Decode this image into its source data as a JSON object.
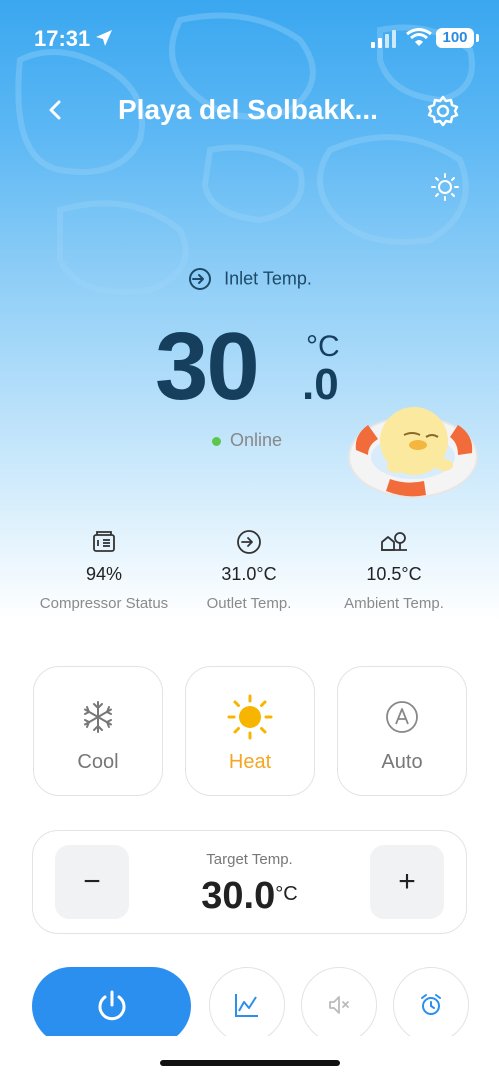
{
  "status_bar": {
    "time": "17:31",
    "battery": "100"
  },
  "header": {
    "title": "Playa del Solbakk..."
  },
  "main": {
    "inlet_label": "Inlet Temp.",
    "temp_integer": "30",
    "temp_decimal": ".0",
    "temp_unit": "°C",
    "status": "Online"
  },
  "stats": [
    {
      "value": "94%",
      "label": "Compressor Status",
      "icon": "compressor-icon"
    },
    {
      "value": "31.0°C",
      "label": "Outlet Temp.",
      "icon": "outlet-icon"
    },
    {
      "value": "10.5°C",
      "label": "Ambient Temp.",
      "icon": "ambient-icon"
    }
  ],
  "modes": [
    {
      "label": "Cool",
      "icon": "snowflake-icon",
      "active": false
    },
    {
      "label": "Heat",
      "icon": "sun-icon",
      "active": true
    },
    {
      "label": "Auto",
      "icon": "auto-icon",
      "active": false
    }
  ],
  "target": {
    "label": "Target Temp.",
    "value": "30.0",
    "unit": "°C",
    "minus": "−",
    "plus": "+"
  },
  "colors": {
    "accent": "#2b8ff0",
    "heat": "#f5a623",
    "online": "#5cc74a",
    "temp_text": "#163f5e"
  }
}
